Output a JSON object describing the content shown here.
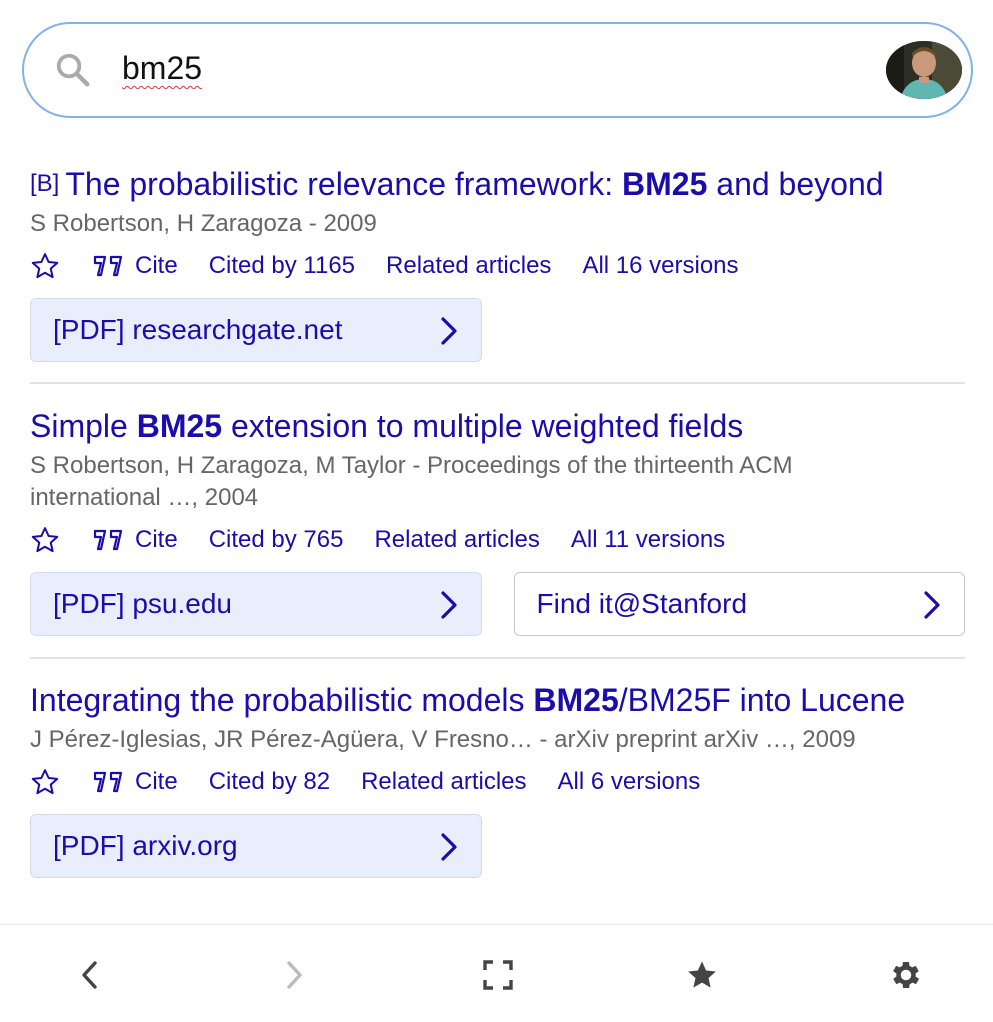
{
  "search": {
    "query": "bm25"
  },
  "results": [
    {
      "tag": "[B]",
      "title_pre": "The probabilistic relevance framework: ",
      "title_bold": "BM25",
      "title_post": " and beyond",
      "authors": "S Robertson, H Zaragoza - 2009",
      "cite": "Cite",
      "cited_by": "Cited by 1165",
      "related": "Related articles",
      "versions": "All 16 versions",
      "pdf_links": [
        "[PDF] researchgate.net"
      ]
    },
    {
      "title_pre": "Simple ",
      "title_bold": "BM25",
      "title_post": " extension to multiple weighted fields",
      "authors_line1": "S Robertson, H Zaragoza, M Taylor - Proceedings of the thirteenth ACM",
      "authors_line2": "international …, 2004",
      "cite": "Cite",
      "cited_by": "Cited by 765",
      "related": "Related articles",
      "versions": "All 11 versions",
      "pdf_links": [
        "[PDF] psu.edu",
        "Find it@Stanford"
      ]
    },
    {
      "title_pre": "Integrating the probabilistic models ",
      "title_bold": "BM25",
      "title_post": "/BM25F into Lucene",
      "authors": "J Pérez-Iglesias, JR Pérez-Agüera, V Fresno… - arXiv preprint arXiv …, 2009",
      "cite": "Cite",
      "cited_by": "Cited by 82",
      "related": "Related articles",
      "versions": "All 6 versions",
      "pdf_links": [
        "[PDF] arxiv.org"
      ]
    }
  ],
  "bottom_nav": {
    "icons": [
      "back-arrow-icon",
      "forward-arrow-icon",
      "fullscreen-icon",
      "star-icon",
      "gear-icon"
    ]
  },
  "colors": {
    "link": "#1a0dab",
    "search_border": "#82b2e6",
    "pdf_bg": "#e8eefc"
  }
}
